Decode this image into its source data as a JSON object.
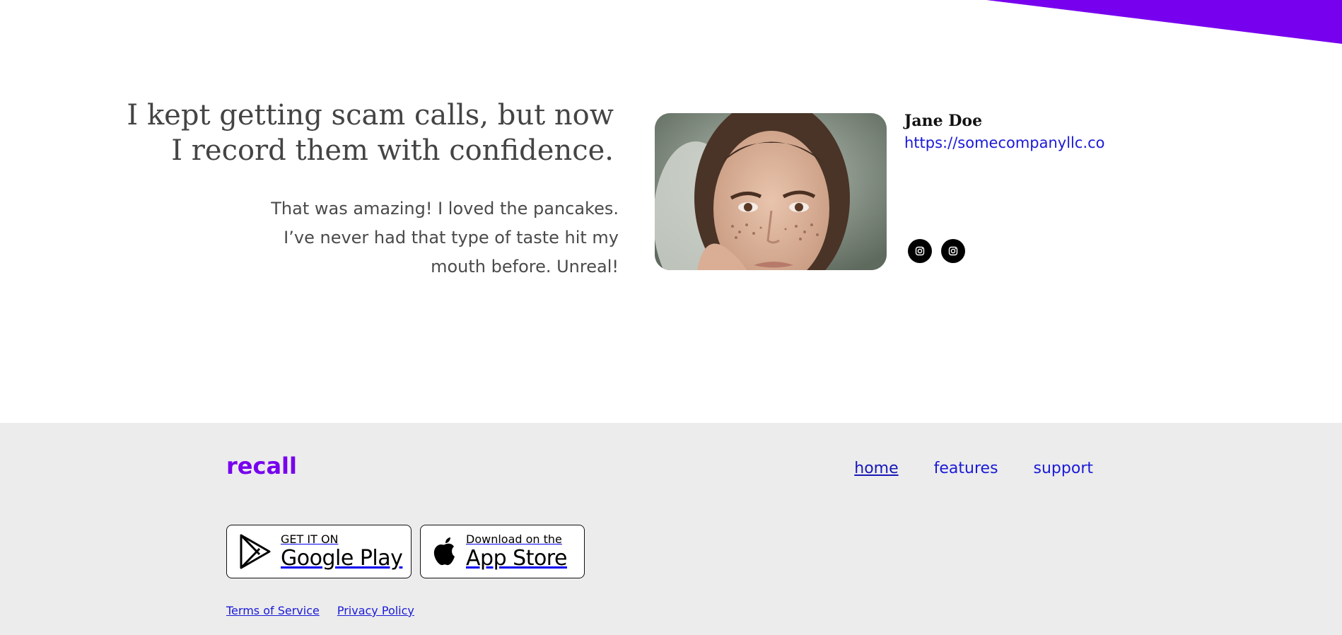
{
  "colors": {
    "brand": "#7700ee",
    "link": "#1a1ad8",
    "footer_bg": "#ececec",
    "text": "#444444"
  },
  "testimonial": {
    "headline": "I kept getting scam calls, but now I record them with confidence.",
    "body": "That was amazing! I loved the pancakes. I’ve never had that type of taste hit my mouth before. Unreal!",
    "author": {
      "name": "Jane Doe",
      "link": "https://somecompanyllc.co"
    },
    "social_icons": [
      "instagram-icon",
      "instagram-icon"
    ]
  },
  "footer": {
    "brand": "recall",
    "nav": [
      {
        "label": "home",
        "active": true
      },
      {
        "label": "features",
        "active": false
      },
      {
        "label": "support",
        "active": false
      }
    ],
    "stores": {
      "google_play": {
        "small": "GET IT ON",
        "big": "Google Play"
      },
      "app_store": {
        "small": "Download on the",
        "big": "App Store"
      }
    },
    "legal": {
      "terms": "Terms of Service",
      "privacy": "Privacy Policy"
    }
  }
}
